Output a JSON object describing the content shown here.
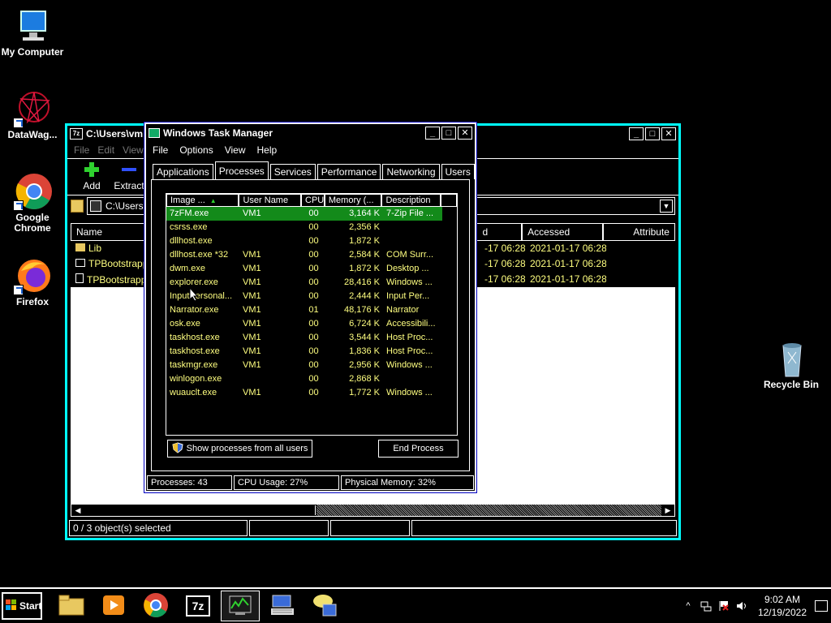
{
  "desktop": {
    "icons": [
      {
        "label": "My Computer"
      },
      {
        "label": "DataWag..."
      },
      {
        "label": "Google Chrome"
      },
      {
        "label": "Firefox"
      },
      {
        "label": "Recycle Bin"
      }
    ]
  },
  "sevenzip": {
    "title": "C:\\Users\\vm",
    "menu": [
      "File",
      "Edit",
      "View"
    ],
    "toolbar": {
      "add": "Add",
      "extract": "Extract"
    },
    "address": "C:\\Users",
    "columns": [
      "Name",
      "d",
      "Accessed",
      "Attribute"
    ],
    "rows": [
      {
        "name": "Lib",
        "modified": "-17 06:28",
        "accessed": "2021-01-17 06:28"
      },
      {
        "name": "TPBootstrapp",
        "modified": "-17 06:28",
        "accessed": "2021-01-17 06:28"
      },
      {
        "name": "TPBootstrapp",
        "modified": "-17 06:28",
        "accessed": "2021-01-17 06:28"
      }
    ],
    "status": "0 / 3 object(s) selected"
  },
  "taskmgr": {
    "title": "Windows Task Manager",
    "menu": [
      "File",
      "Options",
      "View",
      "Help"
    ],
    "tabs": [
      "Applications",
      "Processes",
      "Services",
      "Performance",
      "Networking",
      "Users"
    ],
    "columns": [
      "Image ...",
      "User Name",
      "CPU",
      "Memory (...",
      "Description"
    ],
    "processes": [
      {
        "image": "7zFM.exe",
        "user": "VM1",
        "cpu": "00",
        "mem": "3,164 K",
        "desc": "7-Zip File ..."
      },
      {
        "image": "csrss.exe",
        "user": "",
        "cpu": "00",
        "mem": "2,356 K",
        "desc": ""
      },
      {
        "image": "dllhost.exe",
        "user": "",
        "cpu": "00",
        "mem": "1,872 K",
        "desc": ""
      },
      {
        "image": "dllhost.exe *32",
        "user": "VM1",
        "cpu": "00",
        "mem": "2,584 K",
        "desc": "COM Surr..."
      },
      {
        "image": "dwm.exe",
        "user": "VM1",
        "cpu": "00",
        "mem": "1,872 K",
        "desc": "Desktop ..."
      },
      {
        "image": "explorer.exe",
        "user": "VM1",
        "cpu": "00",
        "mem": "28,416 K",
        "desc": "Windows ..."
      },
      {
        "image": "InputPersonal...",
        "user": "VM1",
        "cpu": "00",
        "mem": "2,444 K",
        "desc": "Input Per..."
      },
      {
        "image": "Narrator.exe",
        "user": "VM1",
        "cpu": "01",
        "mem": "48,176 K",
        "desc": "Narrator"
      },
      {
        "image": "osk.exe",
        "user": "VM1",
        "cpu": "00",
        "mem": "6,724 K",
        "desc": "Accessibili..."
      },
      {
        "image": "taskhost.exe",
        "user": "VM1",
        "cpu": "00",
        "mem": "3,544 K",
        "desc": "Host Proc..."
      },
      {
        "image": "taskhost.exe",
        "user": "VM1",
        "cpu": "00",
        "mem": "1,836 K",
        "desc": "Host Proc..."
      },
      {
        "image": "taskmgr.exe",
        "user": "VM1",
        "cpu": "00",
        "mem": "2,956 K",
        "desc": "Windows ..."
      },
      {
        "image": "winlogon.exe",
        "user": "",
        "cpu": "00",
        "mem": "2,868 K",
        "desc": ""
      },
      {
        "image": "wuauclt.exe",
        "user": "VM1",
        "cpu": "00",
        "mem": "1,772 K",
        "desc": "Windows ..."
      }
    ],
    "show_all_label": "Show processes from all users",
    "end_process_label": "End Process",
    "status": {
      "processes": "Processes: 43",
      "cpu": "CPU Usage: 27%",
      "memory": "Physical Memory: 32%"
    }
  },
  "taskbar": {
    "start_label": "Start",
    "time": "9:02 AM",
    "date": "12/19/2022"
  }
}
